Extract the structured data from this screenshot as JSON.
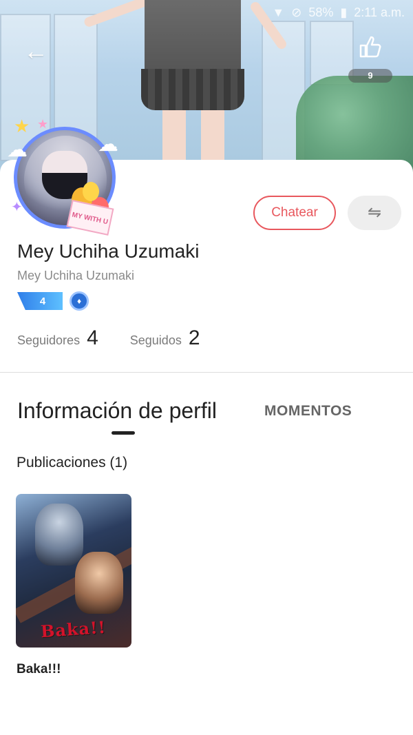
{
  "status_bar": {
    "battery": "58%",
    "time": "2:11 a.m."
  },
  "header": {
    "likes_count": "9"
  },
  "profile": {
    "name": "Mey Uchiha Uzumaki",
    "nickname": "Mey Uchiha Uzumaki",
    "level": "4",
    "avatar_frame_text": "MY WITH U",
    "chat_button_label": "Chatear",
    "followers_label": "Seguidores",
    "followers_count": "4",
    "following_label": "Seguidos",
    "following_count": "2"
  },
  "tabs": [
    {
      "label": "Información de perfil",
      "active": true
    },
    {
      "label": "MOMENTOS",
      "active": false
    }
  ],
  "posts": {
    "heading": "Publicaciones (1)",
    "items": [
      {
        "title": "Baka!!!",
        "image_text": "Baka!!"
      }
    ]
  },
  "colors": {
    "accent": "#e8575d",
    "level_badge": "#2f7ee9",
    "avatar_ring": "#6b8cff"
  },
  "icons": {
    "back": "back-arrow-icon",
    "like": "thumbs-up-icon",
    "swap": "swap-arrows-icon",
    "curator": "curator-badge-icon"
  }
}
